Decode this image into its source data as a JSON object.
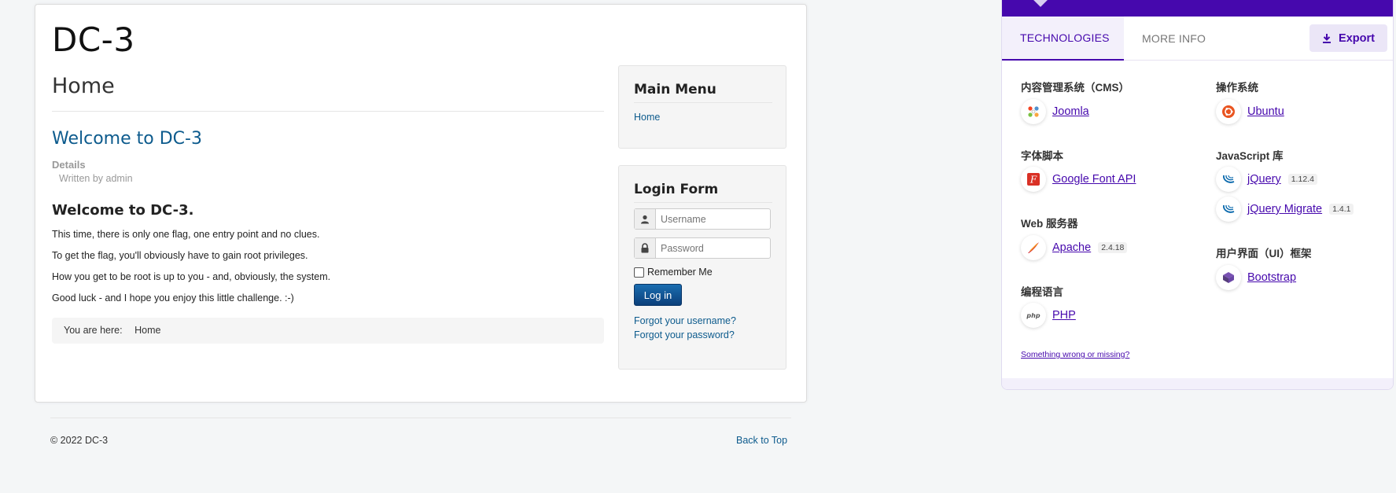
{
  "site": {
    "brand": "DC-3",
    "page_heading": "Home",
    "article": {
      "title": "Welcome to DC-3",
      "details_label": "Details",
      "written_by": "Written by admin",
      "subheading": "Welcome to DC-3.",
      "paragraphs": [
        "This time, there is only one flag, one entry point and no clues.",
        "To get the flag, you'll obviously have to gain root privileges.",
        "How you get to be root is up to you - and, obviously, the system.",
        "Good luck - and I hope you enjoy this little challenge.  :-)"
      ]
    },
    "breadcrumb": {
      "label": "You are here:",
      "current": "Home"
    },
    "main_menu": {
      "title": "Main Menu",
      "items": [
        "Home"
      ]
    },
    "login_form": {
      "title": "Login Form",
      "username_placeholder": "Username",
      "password_placeholder": "Password",
      "remember_label": "Remember Me",
      "login_button": "Log in",
      "forgot_username": "Forgot your username?",
      "forgot_password": "Forgot your password?"
    },
    "footer": {
      "copyright": "© 2022 DC-3",
      "back_to_top": "Back to Top"
    }
  },
  "wappalyzer": {
    "tabs": [
      "TECHNOLOGIES",
      "MORE INFO"
    ],
    "active_tab": "TECHNOLOGIES",
    "export_label": "Export",
    "accent_color": "#4608ad",
    "left_column": [
      {
        "category": "内容管理系统（CMS）",
        "techs": [
          {
            "name": "Joomla",
            "version": "",
            "icon": "joomla-icon"
          }
        ]
      },
      {
        "category": "字体脚本",
        "techs": [
          {
            "name": "Google Font API",
            "version": "",
            "icon": "google-font-icon"
          }
        ]
      },
      {
        "category": "Web 服务器",
        "techs": [
          {
            "name": "Apache",
            "version": "2.4.18",
            "icon": "apache-feather-icon"
          }
        ]
      },
      {
        "category": "编程语言",
        "techs": [
          {
            "name": "PHP",
            "version": "",
            "icon": "php-icon"
          }
        ]
      }
    ],
    "right_column": [
      {
        "category": "操作系统",
        "techs": [
          {
            "name": "Ubuntu",
            "version": "",
            "icon": "ubuntu-icon"
          }
        ]
      },
      {
        "category": "JavaScript 库",
        "techs": [
          {
            "name": "jQuery",
            "version": "1.12.4",
            "icon": "jquery-icon"
          },
          {
            "name": "jQuery Migrate",
            "version": "1.4.1",
            "icon": "jquery-icon"
          }
        ]
      },
      {
        "category": "用户界面（UI）框架",
        "techs": [
          {
            "name": "Bootstrap",
            "version": "",
            "icon": "bootstrap-icon"
          }
        ]
      }
    ],
    "feedback_link": "Something wrong or missing?"
  }
}
